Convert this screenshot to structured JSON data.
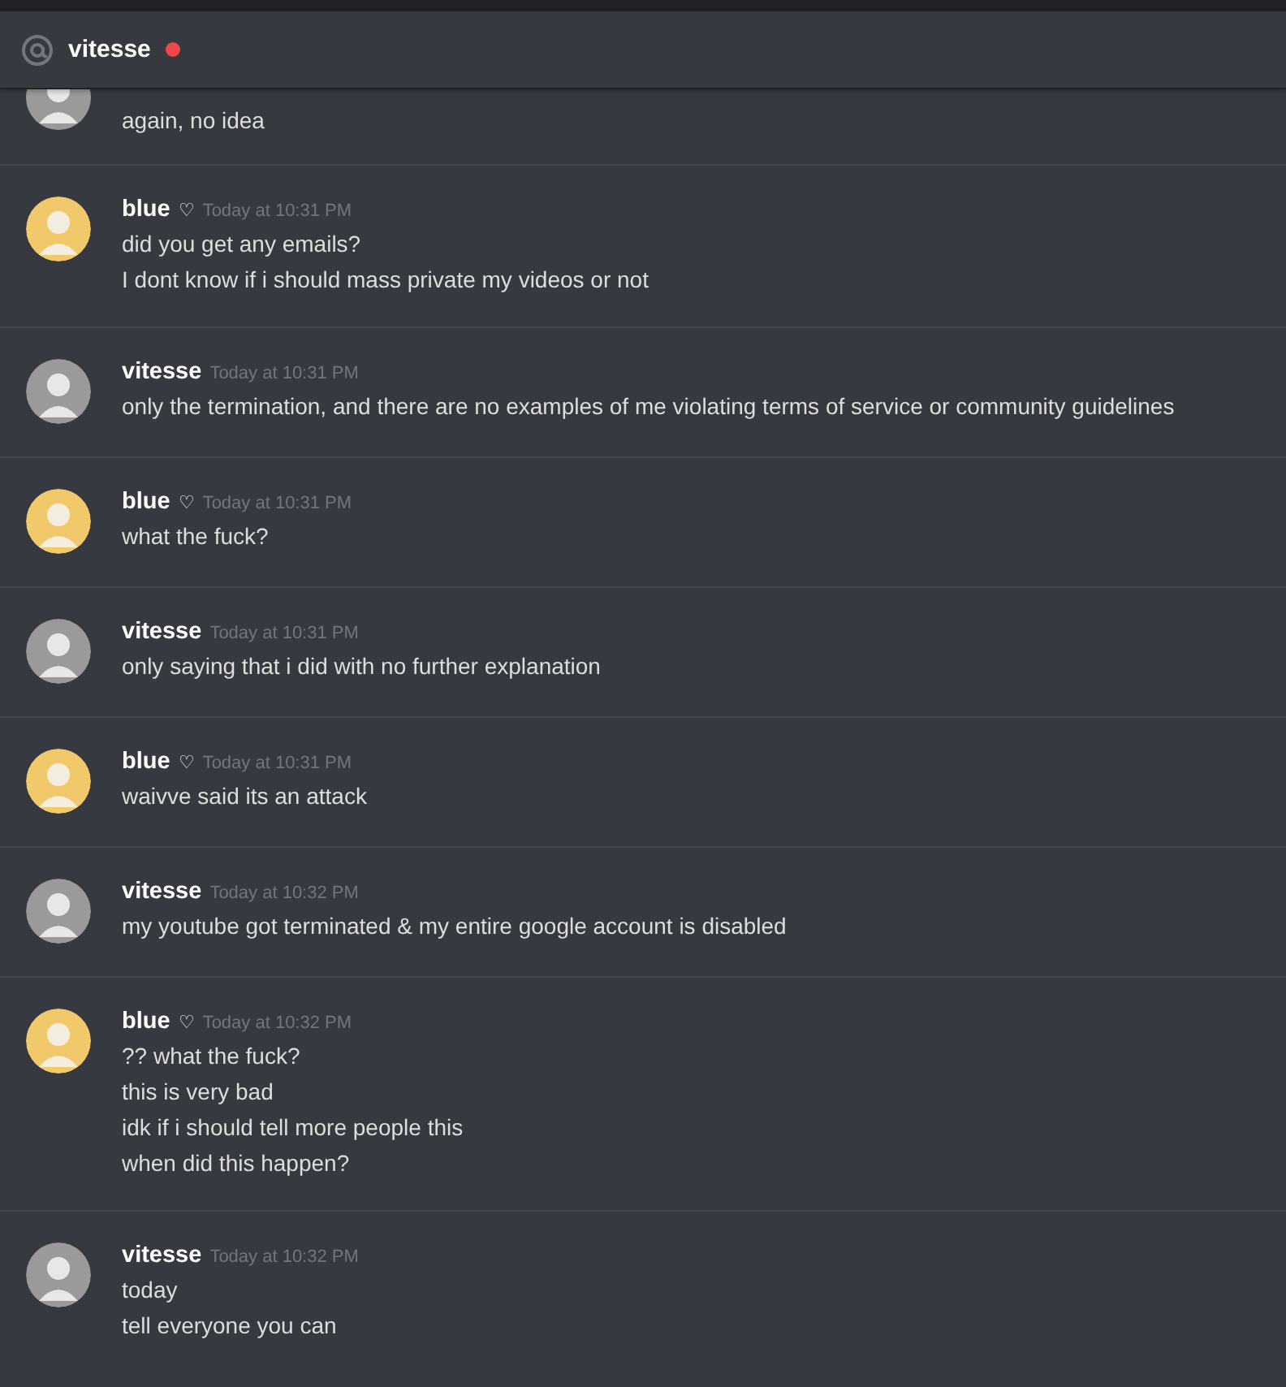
{
  "header": {
    "channel": "vitesse",
    "status": {
      "color": "#f04747"
    }
  },
  "messages": [
    {
      "kind": "partial",
      "color": "#9a9a9a",
      "lines": [
        "again, no idea"
      ]
    },
    {
      "kind": "full",
      "author": "blue",
      "badge": "♡",
      "time": "Today at 10:31 PM",
      "color": "#f2c96a",
      "lines": [
        "did you get any emails?",
        "I dont know if i should mass private my videos or not"
      ]
    },
    {
      "kind": "full",
      "author": "vitesse",
      "time": "Today at 10:31 PM",
      "color": "#9a9a9a",
      "lines": [
        "only the termination, and there are no examples of me violating terms of service or community guidelines"
      ]
    },
    {
      "kind": "full",
      "author": "blue",
      "badge": "♡",
      "time": "Today at 10:31 PM",
      "color": "#f2c96a",
      "lines": [
        "what the fuck?"
      ]
    },
    {
      "kind": "full",
      "author": "vitesse",
      "time": "Today at 10:31 PM",
      "color": "#9a9a9a",
      "lines": [
        "only saying that i did with no further explanation"
      ]
    },
    {
      "kind": "full",
      "author": "blue",
      "badge": "♡",
      "time": "Today at 10:31 PM",
      "color": "#f2c96a",
      "lines": [
        "waivve said its an attack"
      ]
    },
    {
      "kind": "full",
      "author": "vitesse",
      "time": "Today at 10:32 PM",
      "color": "#9a9a9a",
      "lines": [
        "my youtube got terminated & my entire google account is disabled"
      ]
    },
    {
      "kind": "full",
      "author": "blue",
      "badge": "♡",
      "time": "Today at 10:32 PM",
      "color": "#f2c96a",
      "lines": [
        "?? what the fuck?",
        "this is very bad",
        "idk if i should tell more people this",
        "when did this happen?"
      ]
    },
    {
      "kind": "full",
      "author": "vitesse",
      "time": "Today at 10:32 PM",
      "color": "#9a9a9a",
      "lines": [
        "today",
        "tell everyone you can"
      ]
    }
  ]
}
